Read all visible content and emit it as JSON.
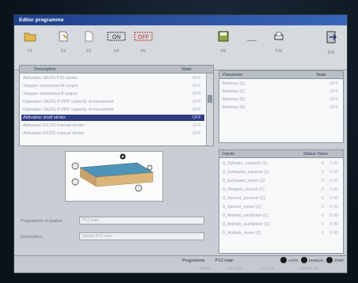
{
  "window": {
    "title": "Editor programme"
  },
  "toolbar": {
    "buttons": [
      {
        "key": "F1",
        "icon": "folder-icon"
      },
      {
        "key": "F2",
        "icon": "document-icon"
      },
      {
        "key": "F3",
        "icon": "page-icon"
      },
      {
        "key": "F4",
        "icon": "on-off-icon",
        "text": "ON"
      },
      {
        "key": "F5",
        "icon": "off-icon",
        "text": "OFF"
      },
      {
        "key": "F8",
        "icon": "save-icon"
      },
      {
        "key": "F10",
        "icon": "print-icon"
      },
      {
        "key": "F12",
        "icon": "exit-icon"
      }
    ]
  },
  "program_list": {
    "header_name": "Description",
    "header_state": "State",
    "rows": [
      {
        "label": "Aktivation SEDG-P10 stroke",
        "state": "OFF"
      },
      {
        "label": "Stopper movement M output",
        "state": "OFF"
      },
      {
        "label": "Stopper movement B output",
        "state": "OFF"
      },
      {
        "label": "Operation SEDG-P PPP capacity of movement",
        "state": "OFF"
      },
      {
        "label": "Operation SEDG-P PPP capacity of movement",
        "state": "OFF"
      },
      {
        "label": "Aktivation shaft stroke",
        "state": "OFF"
      },
      {
        "label": "Aktivation D1-D2 manual stroke",
        "state": "OFF"
      },
      {
        "label": "Aktivation D1/D2 manual stroke",
        "state": "OFF"
      }
    ]
  },
  "properties": {
    "header_name": "Parameter",
    "header_state": "State",
    "rows": [
      {
        "label": "Memory (1)",
        "state": "OFF"
      },
      {
        "label": "Memory (2)",
        "state": "OFF"
      },
      {
        "label": "Memory (3)",
        "state": "OFF"
      },
      {
        "label": "Memory (4)",
        "state": "OFF"
      }
    ]
  },
  "inputs": {
    "header_name": "Inputs",
    "header_state": "Status Value",
    "rows": [
      {
        "label": "0_Zylinder_zurueck (1)",
        "state": "0",
        "value": "0.00"
      },
      {
        "label": "0_Gehause_zurueck (1)",
        "state": "0",
        "value": "0.00"
      },
      {
        "label": "0_Gehause_vorne (1)",
        "state": "0",
        "value": "0.00"
      },
      {
        "label": "0_Stopper_zuruck (1)",
        "state": "0",
        "value": "0.00"
      },
      {
        "label": "0_Sensor_zurueck (1)",
        "state": "0",
        "value": "0.00"
      },
      {
        "label": "0_Sensor_vorne (1)",
        "state": "0",
        "value": "0.00"
      },
      {
        "label": "0_Antrieb_einfahren (1)",
        "state": "0",
        "value": "0.00"
      },
      {
        "label": "0_Antrieb_ausfahren (1)",
        "state": "0",
        "value": "0.00"
      },
      {
        "label": "0_Antrieb_vorne (1)",
        "state": "0",
        "value": "0.00"
      }
    ]
  },
  "form": {
    "field1_label": "Programme of station",
    "field1_value": "P12 main",
    "field2_label": "Description",
    "field2_value": "Station P12 main"
  },
  "status": {
    "left_label": "Programme",
    "left_value": "P12 main",
    "indicators": [
      "AUTO",
      "MANUAL",
      "STOP"
    ],
    "bottom_items": [
      "Ready",
      "P12 main",
      "15:37:19",
      "2005-03-24"
    ]
  },
  "colors": {
    "titlebar": "#2a52a3",
    "selection": "#2f3b83"
  }
}
